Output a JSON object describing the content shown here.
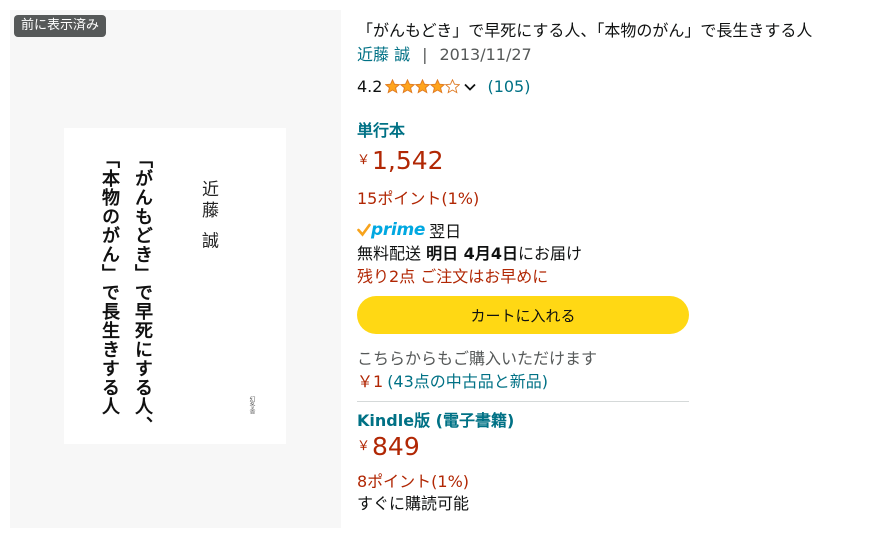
{
  "badge": "前に表示済み",
  "cover": {
    "title_col1": "「がんもどき」で早死にする人、",
    "title_col2": "「本物のがん」で長生きする人",
    "author": "近藤 誠",
    "publisher": "幻冬舎"
  },
  "product": {
    "title": "「がんもどき」で早死にする人、「本物のがん」で長生きする人",
    "author": "近藤 誠",
    "separator": "|",
    "date": "2013/11/27",
    "rating": "4.2",
    "rating_stars": 4.2,
    "review_count": "(105)"
  },
  "formats": [
    {
      "name": "単行本",
      "currency": "￥",
      "price": "1,542",
      "points": "15ポイント(1%)"
    },
    {
      "name": "Kindle版 (電子書籍)",
      "currency": "￥",
      "price": "849",
      "points": "8ポイント(1%)",
      "availability": "すぐに購読可能"
    }
  ],
  "delivery": {
    "prime_label": "prime",
    "prime_day": "翌日",
    "text_prefix": "無料配送",
    "date_bold": "明日 4月4日",
    "text_suffix": "にお届け",
    "stock": "残り2点 ご注文はお早めに"
  },
  "cart_button": "カートに入れる",
  "other_offers": {
    "label": "こちらからもご購入いただけます",
    "price": "￥1",
    "link": "(43点の中古品と新品)"
  },
  "colors": {
    "link": "#007185",
    "price": "#b12704",
    "star": "#ffa41c",
    "button": "#ffd814",
    "prime": "#00a8e1"
  },
  "icons": [
    "star-icon",
    "chevron-down-icon",
    "prime-check-icon"
  ]
}
